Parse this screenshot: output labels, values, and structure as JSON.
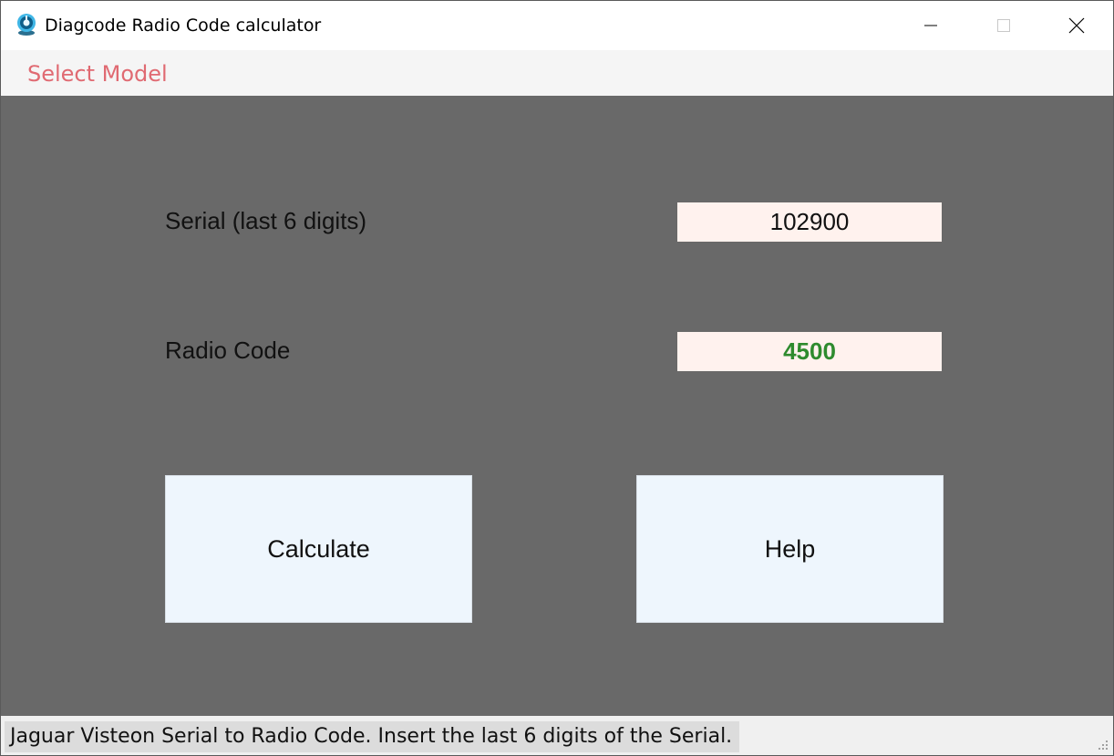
{
  "window": {
    "title": "Diagcode Radio Code calculator",
    "icon": "diagcode-app-icon"
  },
  "menu": {
    "items": [
      {
        "label": "Select Model"
      }
    ]
  },
  "form": {
    "serial_label": "Serial (last 6 digits)",
    "serial_value": "102900",
    "code_label": "Radio Code",
    "code_value": "4500"
  },
  "buttons": {
    "calculate_label": "Calculate",
    "help_label": "Help"
  },
  "status": {
    "text": "Jaguar Visteon Serial to Radio Code. Insert the last 6 digits of the Serial."
  },
  "colors": {
    "panel_background": "#696969",
    "field_background": "#fff2ee",
    "button_background": "#eef6fd",
    "menu_text": "#e06a72",
    "code_text": "#2e8b2e"
  }
}
